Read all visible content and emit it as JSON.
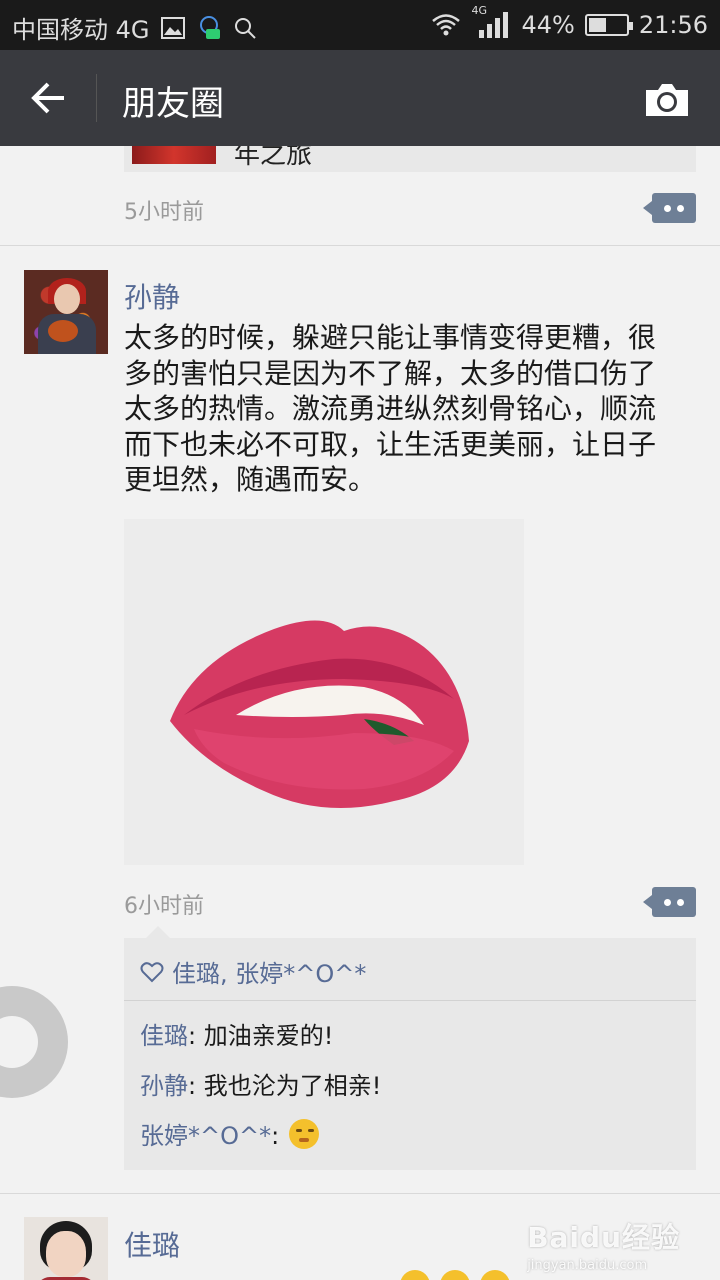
{
  "status_bar": {
    "carrier": "中国移动 4G",
    "network_small": "4G",
    "battery_level": "44%",
    "battery_fraction": 0.44,
    "time": "21:56"
  },
  "nav": {
    "title": "朋友圈",
    "back_icon": "arrow-left-icon",
    "camera_icon": "camera-icon"
  },
  "feed": {
    "previous_post": {
      "share_text": "年之旅",
      "time": "5小时前"
    },
    "post": {
      "author": "孙静",
      "text": "太多的时候，躲避只能让事情变得更糟，很\n多的害怕只是因为不了解，太多的借口伤了\n太多的热情。激流勇进纵然刻骨铭心，顺流\n而下也未必不可取，让生活更美丽，让日子\n更坦然，随遇而安。",
      "time": "6小时前",
      "likes": "佳璐, 张婷*^O^*",
      "comments": [
        {
          "author": "佳璐",
          "separator": ": ",
          "text": "加油亲爱的!"
        },
        {
          "author": "孙静",
          "separator": ": ",
          "text": "我也沦为了相亲!"
        },
        {
          "author": "张婷*^O^*",
          "separator": ": ",
          "text": "",
          "emoji": "thinking-face-emoji"
        }
      ]
    },
    "next_post": {
      "author": "佳璐"
    }
  },
  "watermark": {
    "main": "Baidu经验",
    "sub": "jingyan.baidu.com"
  },
  "colors": {
    "status_bar_bg": "#1a1a1a",
    "nav_bg": "#393a3f",
    "name_link": "#576b95",
    "page_bg": "#f2f2f2",
    "comment_area_bg": "#e8e8e8"
  }
}
